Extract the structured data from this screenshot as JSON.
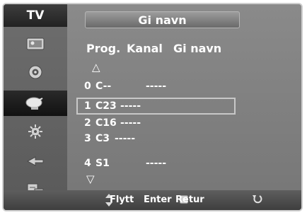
{
  "sidebar": {
    "title": "TV",
    "items": [
      {
        "icon": "picture-icon"
      },
      {
        "icon": "sound-icon"
      },
      {
        "icon": "channel-icon",
        "active": true
      },
      {
        "icon": "setup-icon"
      },
      {
        "icon": "input-icon"
      },
      {
        "icon": "application-icon"
      }
    ]
  },
  "title": "Gi navn",
  "columns": {
    "prog": "Prog.",
    "kanal": "Kanal",
    "name": "Gi navn"
  },
  "up_arrow": "△",
  "down_arrow": "▽",
  "rows": [
    {
      "prog": "0",
      "kanal": "C--",
      "name": "-----",
      "selected": false
    },
    {
      "prog": "1",
      "kanal": "C23",
      "name": "-----",
      "selected": true
    },
    {
      "prog": "2",
      "kanal": "C16",
      "name": "-----",
      "selected": false
    },
    {
      "prog": "3",
      "kanal": "C3",
      "name": "-----",
      "selected": false
    },
    {
      "prog": "4",
      "kanal": "S1",
      "name": "-----",
      "selected": false
    }
  ],
  "footer": {
    "move": "Flytt",
    "enter": "Enter",
    "return": "Retur"
  }
}
